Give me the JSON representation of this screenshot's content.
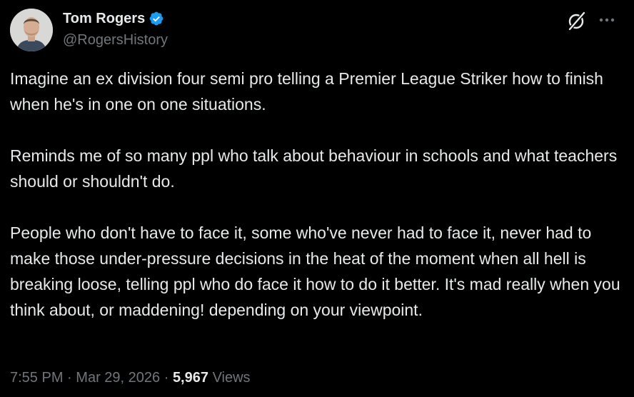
{
  "author": {
    "display_name": "Tom Rogers",
    "handle": "@RogersHistory",
    "verified": true,
    "verified_color": "#1d9bf0"
  },
  "icons": {
    "grok": "grok-icon",
    "more": "more-horizontal-icon",
    "verified": "verified-badge-icon"
  },
  "tweet": {
    "paragraphs": [
      "Imagine an ex division four semi pro telling a Premier League Striker how to finish when he's in one on one situations.",
      "Reminds me of so many ppl who talk about behaviour in schools and what teachers should or shouldn't do.",
      "People who don't have to face it, some who've never had to face it, never had to make those under-pressure decisions in the heat of the moment when all hell is breaking loose, telling ppl who do face it how to do it better. It's mad really when you think about, or maddening! depending on your viewpoint."
    ]
  },
  "meta": {
    "time": "7:55 PM",
    "date": "Mar 29, 2026",
    "separator": "·",
    "views_count": "5,967",
    "views_label": "Views"
  },
  "colors": {
    "background": "#000000",
    "text_primary": "#e7e9ea",
    "text_secondary": "#71767b"
  }
}
